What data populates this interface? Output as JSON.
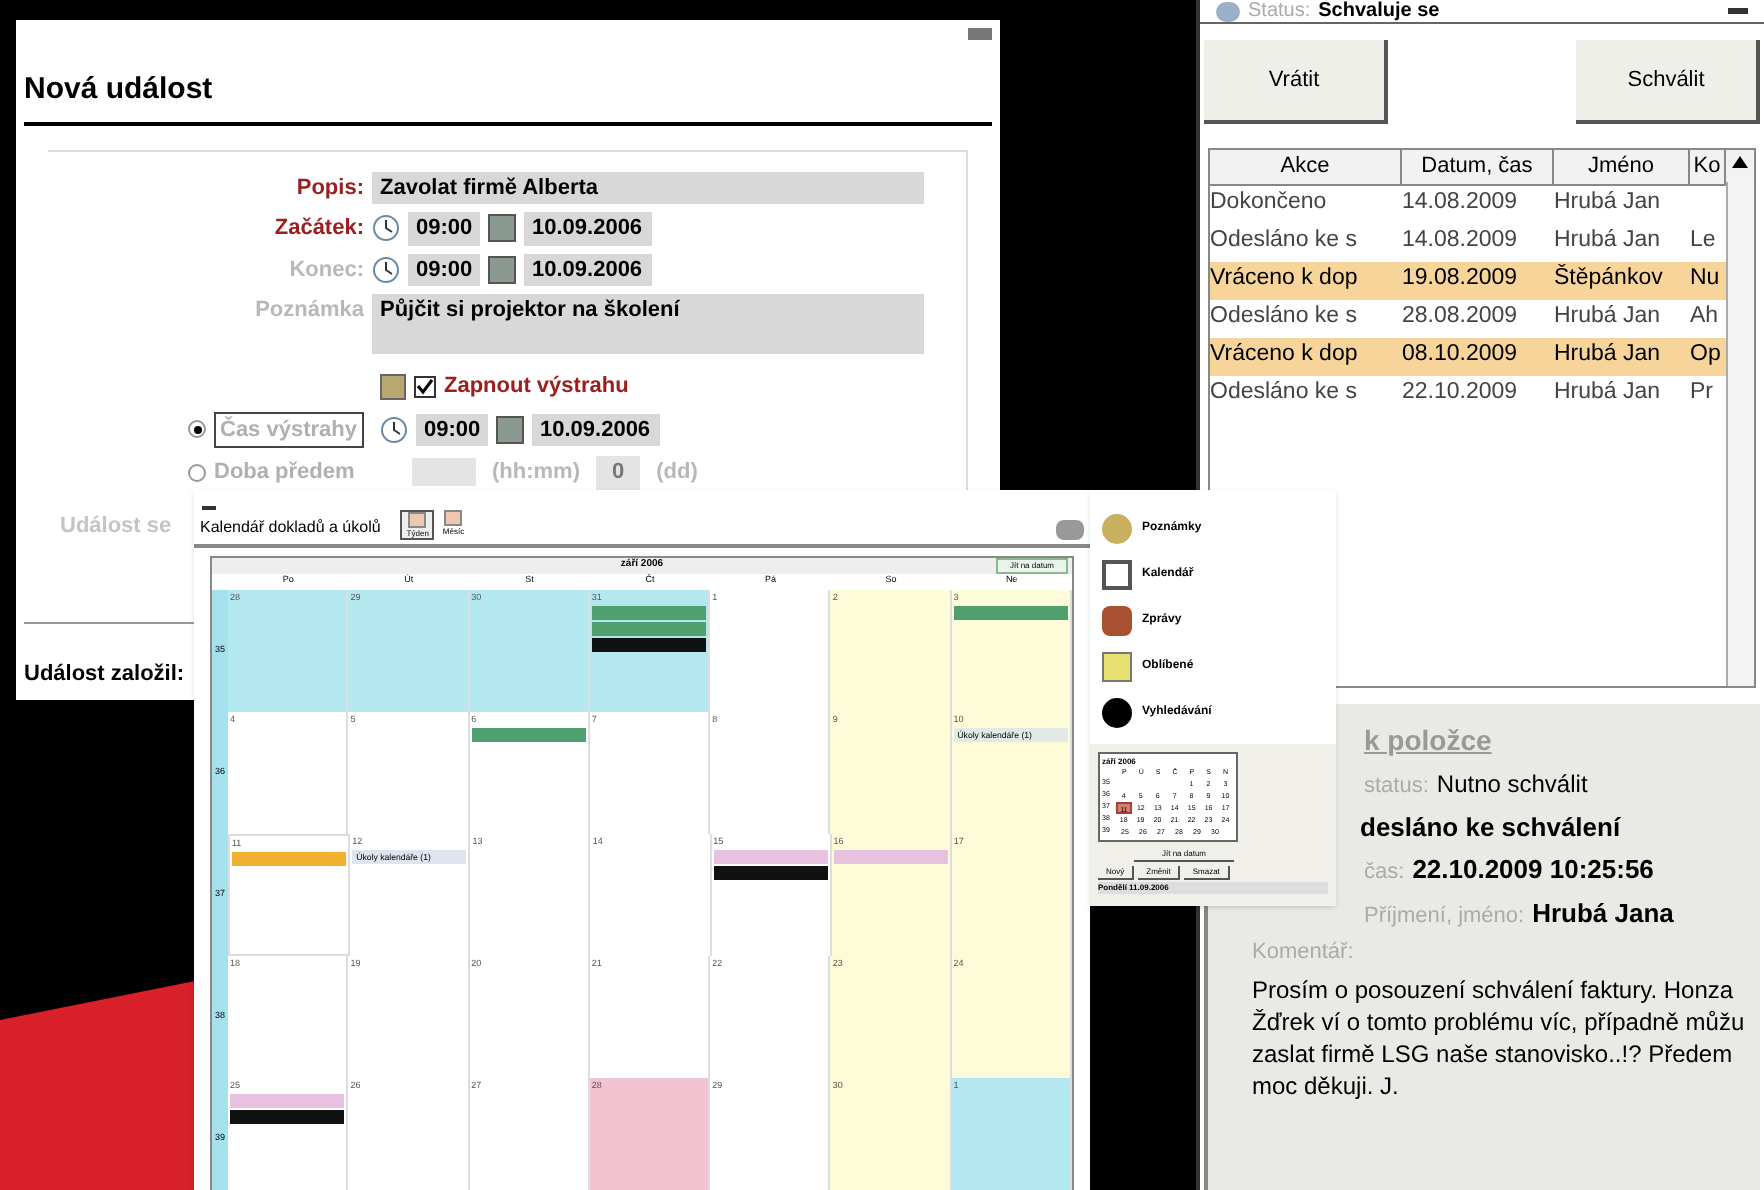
{
  "event_window": {
    "title": "Nová událost",
    "fields": [
      {
        "kind": "text",
        "label": "Popis:",
        "required": true,
        "value": "Zavolat firmě Alberta"
      },
      {
        "kind": "datetime",
        "label": "Začátek:",
        "required": true,
        "time": "09:00",
        "date": "10.09.2006"
      },
      {
        "kind": "datetime",
        "label": "Konec:",
        "required": false,
        "time": "09:00",
        "date": "10.09.2006"
      },
      {
        "kind": "note",
        "label": "Poznámka",
        "required": false,
        "value": "Půjčit si projektor na školení"
      }
    ],
    "alarm": {
      "label": "Zapnout výstrahu",
      "checked": true
    },
    "options": [
      {
        "kind": "datetime",
        "label": "Čas výstrahy",
        "selected": true,
        "time": "09:00",
        "date": "10.09.2006"
      },
      {
        "kind": "duration",
        "label": "Doba předem",
        "selected": false,
        "unit1": "(hh:mm)",
        "days": "0",
        "unit2": "(dd)"
      }
    ],
    "cut_label": "Událost se",
    "footer": "Událost založil:"
  },
  "approval_window": {
    "status_label": "Status:",
    "status": "Schvaluje se",
    "buttons": [
      "Vrátit",
      "Schválit"
    ],
    "columns": [
      "Akce",
      "Datum, čas",
      "Jméno",
      "Ko"
    ],
    "rows": [
      {
        "cells": [
          "Dokončeno",
          "14.08.2009",
          "Hrubá Jan",
          ""
        ],
        "highlighted": false
      },
      {
        "cells": [
          "Odesláno ke s",
          "14.08.2009",
          "Hrubá Jan",
          "Le"
        ],
        "highlighted": false
      },
      {
        "cells": [
          "Vráceno k dop",
          "19.08.2009",
          "Štěpánkov",
          "Nu"
        ],
        "highlighted": true
      },
      {
        "cells": [
          "Odesláno ke s",
          "28.08.2009",
          "Hrubá Jan",
          "Ah"
        ],
        "highlighted": false
      },
      {
        "cells": [
          "Vráceno k dop",
          "08.10.2009",
          "Hrubá Jan",
          "Op"
        ],
        "highlighted": true
      },
      {
        "cells": [
          "Odesláno ke s",
          "22.10.2009",
          "Hrubá Jan",
          "Pr"
        ],
        "highlighted": false
      }
    ],
    "detail": {
      "link": "k položce",
      "status_caption": "status:",
      "status_value": "Nutno schválit",
      "state": "desláno ke schválení",
      "time_caption": "čas:",
      "time_value": "22.10.2009 10:25:56",
      "name_caption": "Příjmení, jméno:",
      "name_value": "Hrubá Jana",
      "comment_caption": "Komentář:",
      "comment": "Prosím o posouzení schválení faktury. Honza Žďrek ví o tomto problému víc, případně můžu zaslat firmě LSG naše stanovisko..!? Předem moc děkuji. J."
    }
  },
  "calendar_window": {
    "title": "Kalendář dokladů a úkolů",
    "views": [
      {
        "label": "Týden",
        "selected": true
      },
      {
        "label": "Měsíc",
        "selected": false
      }
    ],
    "month": "září 2006",
    "goto": "Jít na datum",
    "weekdays": [
      "Po",
      "Út",
      "St",
      "Čt",
      "Pá",
      "So",
      "Ne"
    ],
    "weeks": [
      {
        "number": "35",
        "days": [
          {
            "day": "28",
            "kind": "other",
            "selected": false
          },
          {
            "day": "29",
            "kind": "other",
            "selected": false
          },
          {
            "day": "30",
            "kind": "other",
            "selected": false
          },
          {
            "day": "31",
            "kind": "other",
            "selected": false,
            "events": [
              {
                "color": "#4f9f6f"
              },
              {
                "color": "#4f9f6f"
              },
              {
                "color": "#111111"
              }
            ]
          },
          {
            "day": "1",
            "kind": "normal",
            "selected": false
          },
          {
            "day": "2",
            "kind": "weekend",
            "selected": false
          },
          {
            "day": "3",
            "kind": "weekend",
            "selected": false,
            "events": [
              {
                "color": "#4f9f6f"
              }
            ]
          }
        ]
      },
      {
        "number": "36",
        "days": [
          {
            "day": "4",
            "kind": "normal",
            "selected": false
          },
          {
            "day": "5",
            "kind": "normal",
            "selected": false
          },
          {
            "day": "6",
            "kind": "normal",
            "selected": false,
            "events": [
              {
                "color": "#4f9f6f"
              }
            ]
          },
          {
            "day": "7",
            "kind": "normal",
            "selected": false
          },
          {
            "day": "8",
            "kind": "normal",
            "selected": false
          },
          {
            "day": "9",
            "kind": "weekend",
            "selected": false
          },
          {
            "day": "10",
            "kind": "weekend",
            "selected": false,
            "events": [
              {
                "color": "#e2eae6",
                "label": "Úkoly kalendáře (1)"
              }
            ]
          }
        ]
      },
      {
        "number": "37",
        "days": [
          {
            "day": "11",
            "kind": "normal",
            "selected": true,
            "events": [
              {
                "color": "#f0b030"
              }
            ]
          },
          {
            "day": "12",
            "kind": "normal",
            "selected": false,
            "events": [
              {
                "color": "#dde6ee",
                "label": "Úkoly kalendáře (1)"
              }
            ]
          },
          {
            "day": "13",
            "kind": "normal",
            "selected": false
          },
          {
            "day": "14",
            "kind": "normal",
            "selected": false
          },
          {
            "day": "15",
            "kind": "normal",
            "selected": false,
            "events": [
              {
                "color": "#e8c0e0"
              },
              {
                "color": "#111111"
              }
            ]
          },
          {
            "day": "16",
            "kind": "weekend",
            "selected": false,
            "events": [
              {
                "color": "#e8c0e0"
              }
            ]
          },
          {
            "day": "17",
            "kind": "weekend",
            "selected": false
          }
        ]
      },
      {
        "number": "38",
        "days": [
          {
            "day": "18",
            "kind": "normal",
            "selected": false
          },
          {
            "day": "19",
            "kind": "normal",
            "selected": false
          },
          {
            "day": "20",
            "kind": "normal",
            "selected": false
          },
          {
            "day": "21",
            "kind": "normal",
            "selected": false
          },
          {
            "day": "22",
            "kind": "normal",
            "selected": false
          },
          {
            "day": "23",
            "kind": "weekend",
            "selected": false
          },
          {
            "day": "24",
            "kind": "weekend",
            "selected": false
          }
        ]
      },
      {
        "number": "39",
        "days": [
          {
            "day": "25",
            "kind": "normal",
            "selected": false,
            "events": [
              {
                "color": "#e8c0e0"
              },
              {
                "color": "#111111"
              }
            ]
          },
          {
            "day": "26",
            "kind": "normal",
            "selected": false
          },
          {
            "day": "27",
            "kind": "normal",
            "selected": false
          },
          {
            "day": "28",
            "kind": "holiday",
            "selected": false
          },
          {
            "day": "29",
            "kind": "normal",
            "selected": false
          },
          {
            "day": "30",
            "kind": "weekend",
            "selected": false
          },
          {
            "day": "1",
            "kind": "other",
            "selected": false
          }
        ]
      }
    ],
    "nav": [
      {
        "kind": "notes",
        "label": "Poznámky"
      },
      {
        "kind": "calendar",
        "label": "Kalendář"
      },
      {
        "kind": "messages",
        "label": "Zprávy"
      },
      {
        "kind": "favorites",
        "label": "Oblíbené"
      },
      {
        "kind": "search",
        "label": "Vyhledávání"
      }
    ],
    "mini": {
      "title": "září 2006",
      "weekdays": [
        "P",
        "Ú",
        "S",
        "Č",
        "P",
        "S",
        "N"
      ],
      "weeks": [
        {
          "number": "35",
          "kind": "first",
          "days": [
            {
              "d": "1",
              "selected": false
            },
            {
              "d": "2",
              "selected": false
            },
            {
              "d": "3",
              "selected": false
            }
          ]
        },
        {
          "number": "36",
          "days": [
            {
              "d": "4",
              "selected": false
            },
            {
              "d": "5",
              "selected": false
            },
            {
              "d": "6",
              "selected": false
            },
            {
              "d": "7",
              "selected": false
            },
            {
              "d": "8",
              "selected": false
            },
            {
              "d": "9",
              "selected": false
            },
            {
              "d": "10",
              "selected": false
            }
          ]
        },
        {
          "number": "37",
          "days": [
            {
              "d": "11",
              "selected": true
            },
            {
              "d": "12",
              "selected": false
            },
            {
              "d": "13",
              "selected": false
            },
            {
              "d": "14",
              "selected": false
            },
            {
              "d": "15",
              "selected": false
            },
            {
              "d": "16",
              "selected": false
            },
            {
              "d": "17",
              "selected": false
            }
          ]
        },
        {
          "number": "38",
          "days": [
            {
              "d": "18",
              "selected": false
            },
            {
              "d": "19",
              "selected": false
            },
            {
              "d": "20",
              "selected": false
            },
            {
              "d": "21",
              "selected": false
            },
            {
              "d": "22",
              "selected": false
            },
            {
              "d": "23",
              "selected": false
            },
            {
              "d": "24",
              "selected": false
            }
          ]
        },
        {
          "number": "39",
          "days": [
            {
              "d": "25",
              "selected": false
            },
            {
              "d": "26",
              "selected": false
            },
            {
              "d": "27",
              "selected": false
            },
            {
              "d": "28",
              "selected": false
            },
            {
              "d": "29",
              "selected": false
            },
            {
              "d": "30",
              "selected": false
            }
          ]
        }
      ],
      "goto": "Jít na datum"
    },
    "actions": [
      "Nový",
      "Změnit",
      "Smazat"
    ],
    "status": "Pondělí 11.09.2006"
  }
}
